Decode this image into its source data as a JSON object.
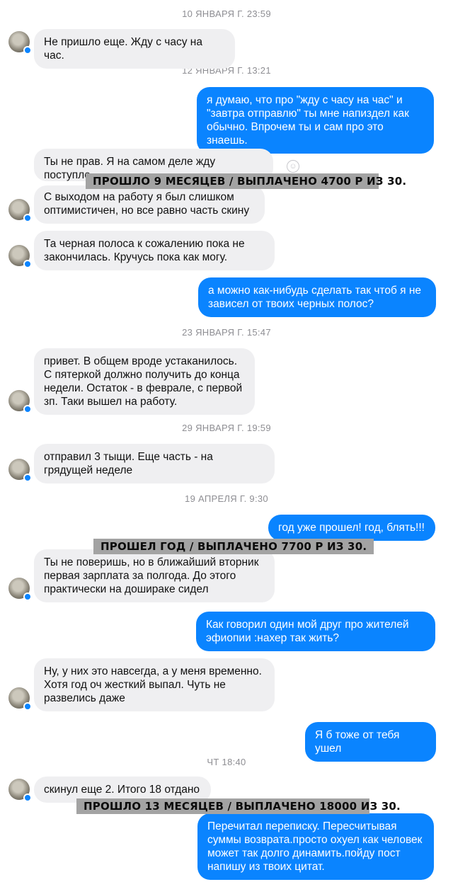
{
  "conversation": {
    "timestamps": [
      "10 ЯНВАРЯ Г. 23:59",
      "12 ЯНВАРЯ Г. 13:21",
      "23 ЯНВАРЯ Г. 15:47",
      "29 ЯНВАРЯ Г. 19:59",
      "19 АПРЕЛЯ Г. 9:30",
      "ЧТ 18:40"
    ],
    "messages": [
      "Не пришло еще. Жду с часу на час.",
      "я думаю, что про \"жду с часу на час\" и \"завтра отправлю\" ты мне напиздел как обычно. Впрочем ты и сам про это знаешь.",
      "Ты не прав. Я на самом деле жду поступле",
      "С выходом на работу я был слишком оптимистичен, но все равно часть скину",
      "Та черная полоса к сожалению пока не закончилась. Кручусь пока как могу.",
      "а можно как-нибудь сделать так чтоб я не зависел от твоих черных полос?",
      "привет. В общем вроде устаканилось. С пятеркой должно получить до конца недели. Остаток - в феврале, с первой зп. Таки вышел на работу.",
      "отправил 3 тыщи. Еще часть - на грядущей неделе",
      "год уже прошел! год, блять!!!",
      "Ты не поверишь, но в ближайший вторник первая зарплата за полгода. До этого практически на дошираке сидел",
      "Как говорил один мой друг про жителей эфиопии :нахер так жить?",
      "Ну, у них это навсегда, а у меня временно. Хотя год оч жесткий выпал. Чуть не развелись даже",
      "Я б тоже от тебя ушел",
      "скинул еще 2. Итого 18 отдано",
      "Перечитал переписку. Пересчитывая суммы возврата.просто охуел как человек может так долго динамить.пойду пост напишу из твоих цитат."
    ]
  },
  "captions": [
    "ПРОШЛО 9 МЕСЯЦЕВ / ВЫПЛАЧЕНО 4700 Р ИЗ 30.",
    "ПРОШЕЛ ГОД / ВЫПЛАЧЕНО 7700 Р ИЗ 30.",
    "ПРОШЛО 13 МЕСЯЦЕВ / ВЫПЛАЧЕНО 18000   ИЗ 30."
  ],
  "icons": {
    "reaction": "smiley-reaction-icon",
    "messenger_badge": "messenger-badge-icon"
  },
  "colors": {
    "outgoing_bubble": "#0a84ff",
    "incoming_bubble": "#efeff1",
    "caption_background": "#a3a3a3"
  }
}
